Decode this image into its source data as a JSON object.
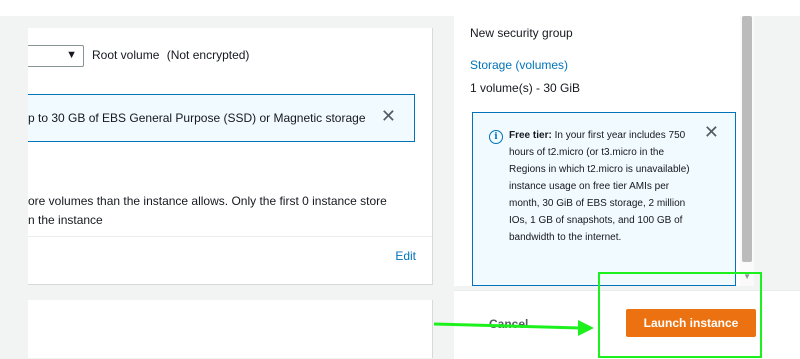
{
  "storage": {
    "root_volume_label": "Root volume",
    "root_volume_encryption": "(Not encrypted)",
    "info_banner_text": "p to 30 GB of EBS General Purpose (SSD) or Magnetic storage",
    "instance_store_text_line1": "ore volumes than the instance allows. Only the first 0 instance store",
    "instance_store_text_line2": "n the instance",
    "edit_label": "Edit"
  },
  "summary": {
    "security_group": "New security group",
    "storage_heading": "Storage (volumes)",
    "storage_value": "1 volume(s) - 30 GiB",
    "free_tier_bold": "Free tier:",
    "free_tier_text": "In your first year includes 750 hours of t2.micro (or t3.micro in the Regions in which t2.micro is unavailable) instance usage on free tier AMIs per month, 30 GiB of EBS storage, 2 million IOs, 1 GB of snapshots, and 100 GB of bandwidth to the internet."
  },
  "footer": {
    "cancel_label": "Cancel",
    "launch_label": "Launch instance"
  },
  "icons": {
    "info": "info-circle-icon",
    "close": "close-icon",
    "caret": "caret-down-icon"
  },
  "colors": {
    "accent": "#0073bb",
    "launch_button": "#ec7211",
    "annotation": "#1df11d"
  }
}
